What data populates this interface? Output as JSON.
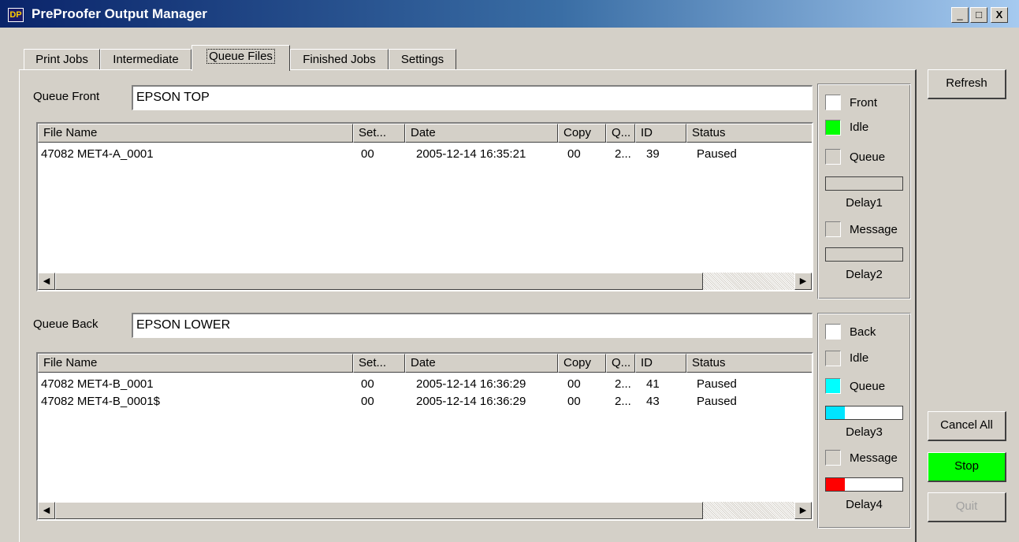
{
  "window": {
    "title": "PreProofer Output Manager",
    "icon": "app-icon",
    "icon_text": "DP",
    "controls": [
      "_",
      "□",
      "X"
    ]
  },
  "tabs": [
    {
      "label": "Print Jobs",
      "active": false
    },
    {
      "label": "Intermediate",
      "active": false
    },
    {
      "label": "Queue Files",
      "active": true
    },
    {
      "label": "Finished Jobs",
      "active": false
    },
    {
      "label": "Settings",
      "active": false
    }
  ],
  "columns": [
    "File Name",
    "Set...",
    "Date",
    "Copy",
    "Q...",
    "ID",
    "Status"
  ],
  "queue_front": {
    "label": "Queue Front",
    "value": "EPSON TOP",
    "rows": [
      {
        "file": "47082 MET4-A_0001",
        "set": "00",
        "date": "2005-12-14 16:35:21",
        "copy": "00",
        "q": "2...",
        "id": "39",
        "status": "Paused"
      }
    ],
    "status": {
      "side": {
        "label": "Front",
        "color": "#ffffff"
      },
      "idle": {
        "label": "Idle",
        "color": "#00ff00"
      },
      "queue": {
        "label": "Queue",
        "color": "#d4d0c8"
      },
      "delay_a": {
        "label": "Delay1",
        "progress": 0,
        "color": "#d4d0c8"
      },
      "message": {
        "label": "Message",
        "color": "#d4d0c8"
      },
      "delay_b": {
        "label": "Delay2",
        "progress": 0,
        "color": "#d4d0c8"
      }
    }
  },
  "queue_back": {
    "label": "Queue Back",
    "value": "EPSON LOWER",
    "rows": [
      {
        "file": "47082 MET4-B_0001",
        "set": "00",
        "date": "2005-12-14 16:36:29",
        "copy": "00",
        "q": "2...",
        "id": "41",
        "status": "Paused"
      },
      {
        "file": "47082 MET4-B_0001$",
        "set": "00",
        "date": "2005-12-14 16:36:29",
        "copy": "00",
        "q": "2...",
        "id": "43",
        "status": "Paused"
      }
    ],
    "status": {
      "side": {
        "label": "Back",
        "color": "#ffffff"
      },
      "idle": {
        "label": "Idle",
        "color": "#d4d0c8"
      },
      "queue": {
        "label": "Queue",
        "color": "#00ffff"
      },
      "delay_a": {
        "label": "Delay3",
        "progress": 0.25,
        "color": "#00e5ff"
      },
      "message": {
        "label": "Message",
        "color": "#d4d0c8"
      },
      "delay_b": {
        "label": "Delay4",
        "progress": 0.25,
        "color": "#ff0000"
      }
    }
  },
  "buttons": {
    "refresh": "Refresh",
    "cancel_all": "Cancel All",
    "stop": "Stop",
    "stop_color": "#00ff00",
    "quit": "Quit",
    "quit_enabled": false
  },
  "scroll_arrows": {
    "left": "◀",
    "right": "▶"
  }
}
